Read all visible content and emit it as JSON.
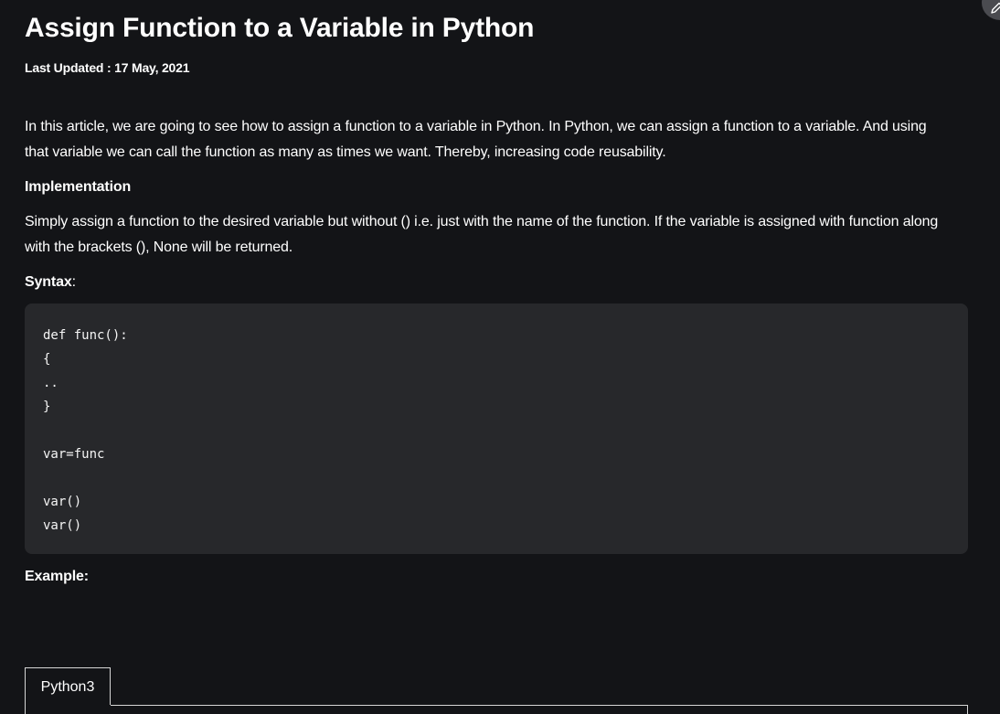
{
  "article": {
    "title": "Assign Function to a Variable in Python",
    "last_updated": "Last Updated : 17 May, 2021",
    "intro": "In this article, we are going to see how to assign a function to a variable in Python. In Python, we can assign a function to a variable. And using that variable we can call the function as many as times we want. Thereby, increasing code reusability.",
    "implementation_heading": "Implementation",
    "implementation_body": "Simply assign a function to the desired variable but without () i.e. just with the name of the function. If the variable is assigned with function along with the brackets (), None will be returned.",
    "syntax_label": "Syntax",
    "syntax_colon": ":",
    "code_lines": [
      "def func():",
      "{",
      "..",
      "}",
      "",
      "var=func",
      "",
      "var()",
      "var()"
    ],
    "example_label": "Example:",
    "tabs": [
      {
        "label": "Python3",
        "selected": true
      }
    ]
  },
  "icons": {
    "edit": "pencil-icon"
  },
  "colors": {
    "background": "#131417",
    "code_background": "#27282b",
    "text": "#ffffff",
    "tab_border": "#d6d6d6"
  }
}
